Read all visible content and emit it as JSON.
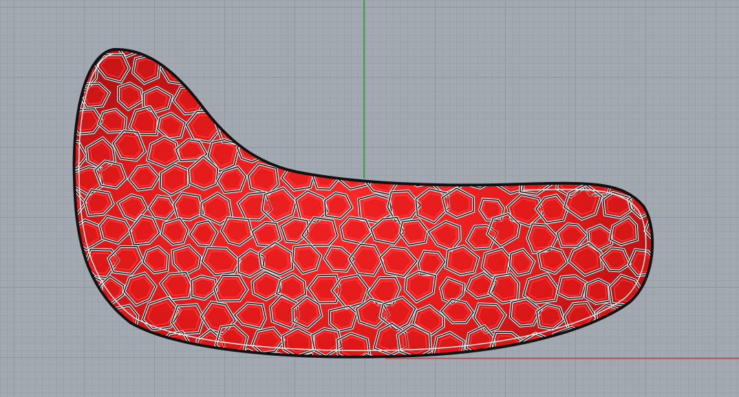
{
  "viewport": {
    "view_mode": "perspective",
    "colors": {
      "background": "#a3a9b1",
      "grid_minor": "#9aa1a9",
      "grid_major": "#8e959e",
      "y_axis": "#1aa51a",
      "x_axis": "#d13a3a",
      "model_fill": "#e0191a",
      "model_fill_dark": "#a80f10",
      "cell_wire": "#1a1a1a",
      "cell_highlight": "#f2f2f2"
    }
  },
  "model": {
    "shape": "voronoi-lattice-shell",
    "cell_pattern": "voronoi-cells"
  }
}
